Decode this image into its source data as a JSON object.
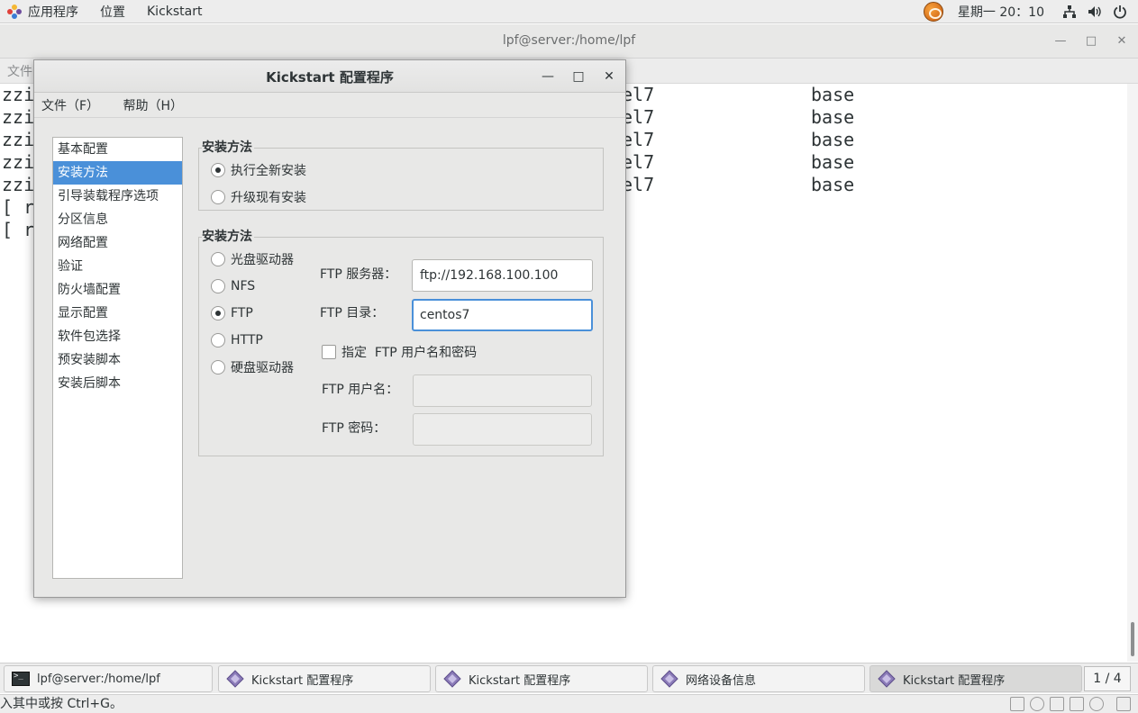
{
  "top_panel": {
    "apps_label": "应用程序",
    "places_label": "位置",
    "active_app_label": "Kickstart",
    "clock": "星期一 20：10"
  },
  "terminal": {
    "title": "lpf@server:/home/lpf",
    "menu_visible_text": "文件",
    "lines_left": [
      "zzi",
      "zzi",
      "zzi",
      "zzi",
      "zzi",
      "[ ro",
      "[ ro"
    ],
    "lines_mid": [
      "el7",
      "el7",
      "el7",
      "el7",
      "el7"
    ],
    "lines_right": [
      "base",
      "base",
      "base",
      "base",
      "base"
    ]
  },
  "dialog": {
    "title": "Kickstart 配置程序",
    "menu": {
      "file": "文件（F）",
      "help": "帮助（H）"
    },
    "sidebar": [
      {
        "label": "基本配置",
        "selected": false
      },
      {
        "label": "安装方法",
        "selected": true
      },
      {
        "label": "引导装载程序选项",
        "selected": false
      },
      {
        "label": "分区信息",
        "selected": false
      },
      {
        "label": "网络配置",
        "selected": false
      },
      {
        "label": "验证",
        "selected": false
      },
      {
        "label": "防火墙配置",
        "selected": false
      },
      {
        "label": "显示配置",
        "selected": false
      },
      {
        "label": "软件包选择",
        "selected": false
      },
      {
        "label": "预安装脚本",
        "selected": false
      },
      {
        "label": "安装后脚本",
        "selected": false
      }
    ],
    "install_type": {
      "title": "安装方法",
      "fresh": "执行全新安装",
      "upgrade": "升级现有安装",
      "selected": "fresh"
    },
    "install_source": {
      "title": "安装方法",
      "cdrom": "光盘驱动器",
      "nfs": "NFS",
      "ftp": "FTP",
      "http": "HTTP",
      "harddrive": "硬盘驱动器",
      "selected": "ftp",
      "ftp_server_label": "FTP 服务器：",
      "ftp_server_value": "ftp://192.168.100.100",
      "ftp_dir_label": "FTP 目录：",
      "ftp_dir_value": "centos7",
      "auth_check_label": "指定  FTP 用户名和密码",
      "auth_checked": false,
      "ftp_user_label": "FTP 用户名：",
      "ftp_user_value": "",
      "ftp_pass_label": "FTP 密码：",
      "ftp_pass_value": ""
    }
  },
  "taskbar": {
    "items": [
      {
        "label": "lpf@server:/home/lpf",
        "icon": "terminal-icon"
      },
      {
        "label": "Kickstart 配置程序",
        "icon": "kickstart-icon"
      },
      {
        "label": "Kickstart 配置程序",
        "icon": "kickstart-icon"
      },
      {
        "label": "网络设备信息",
        "icon": "kickstart-icon"
      },
      {
        "label": "Kickstart 配置程序",
        "icon": "kickstart-icon"
      }
    ],
    "pager": "1 / 4"
  },
  "statusbar": {
    "text": "入其中或按 Ctrl+G。"
  },
  "colors": {
    "selection": "#4a90d9",
    "panel": "#ededed",
    "dialog_bg": "#e8e8e7"
  }
}
